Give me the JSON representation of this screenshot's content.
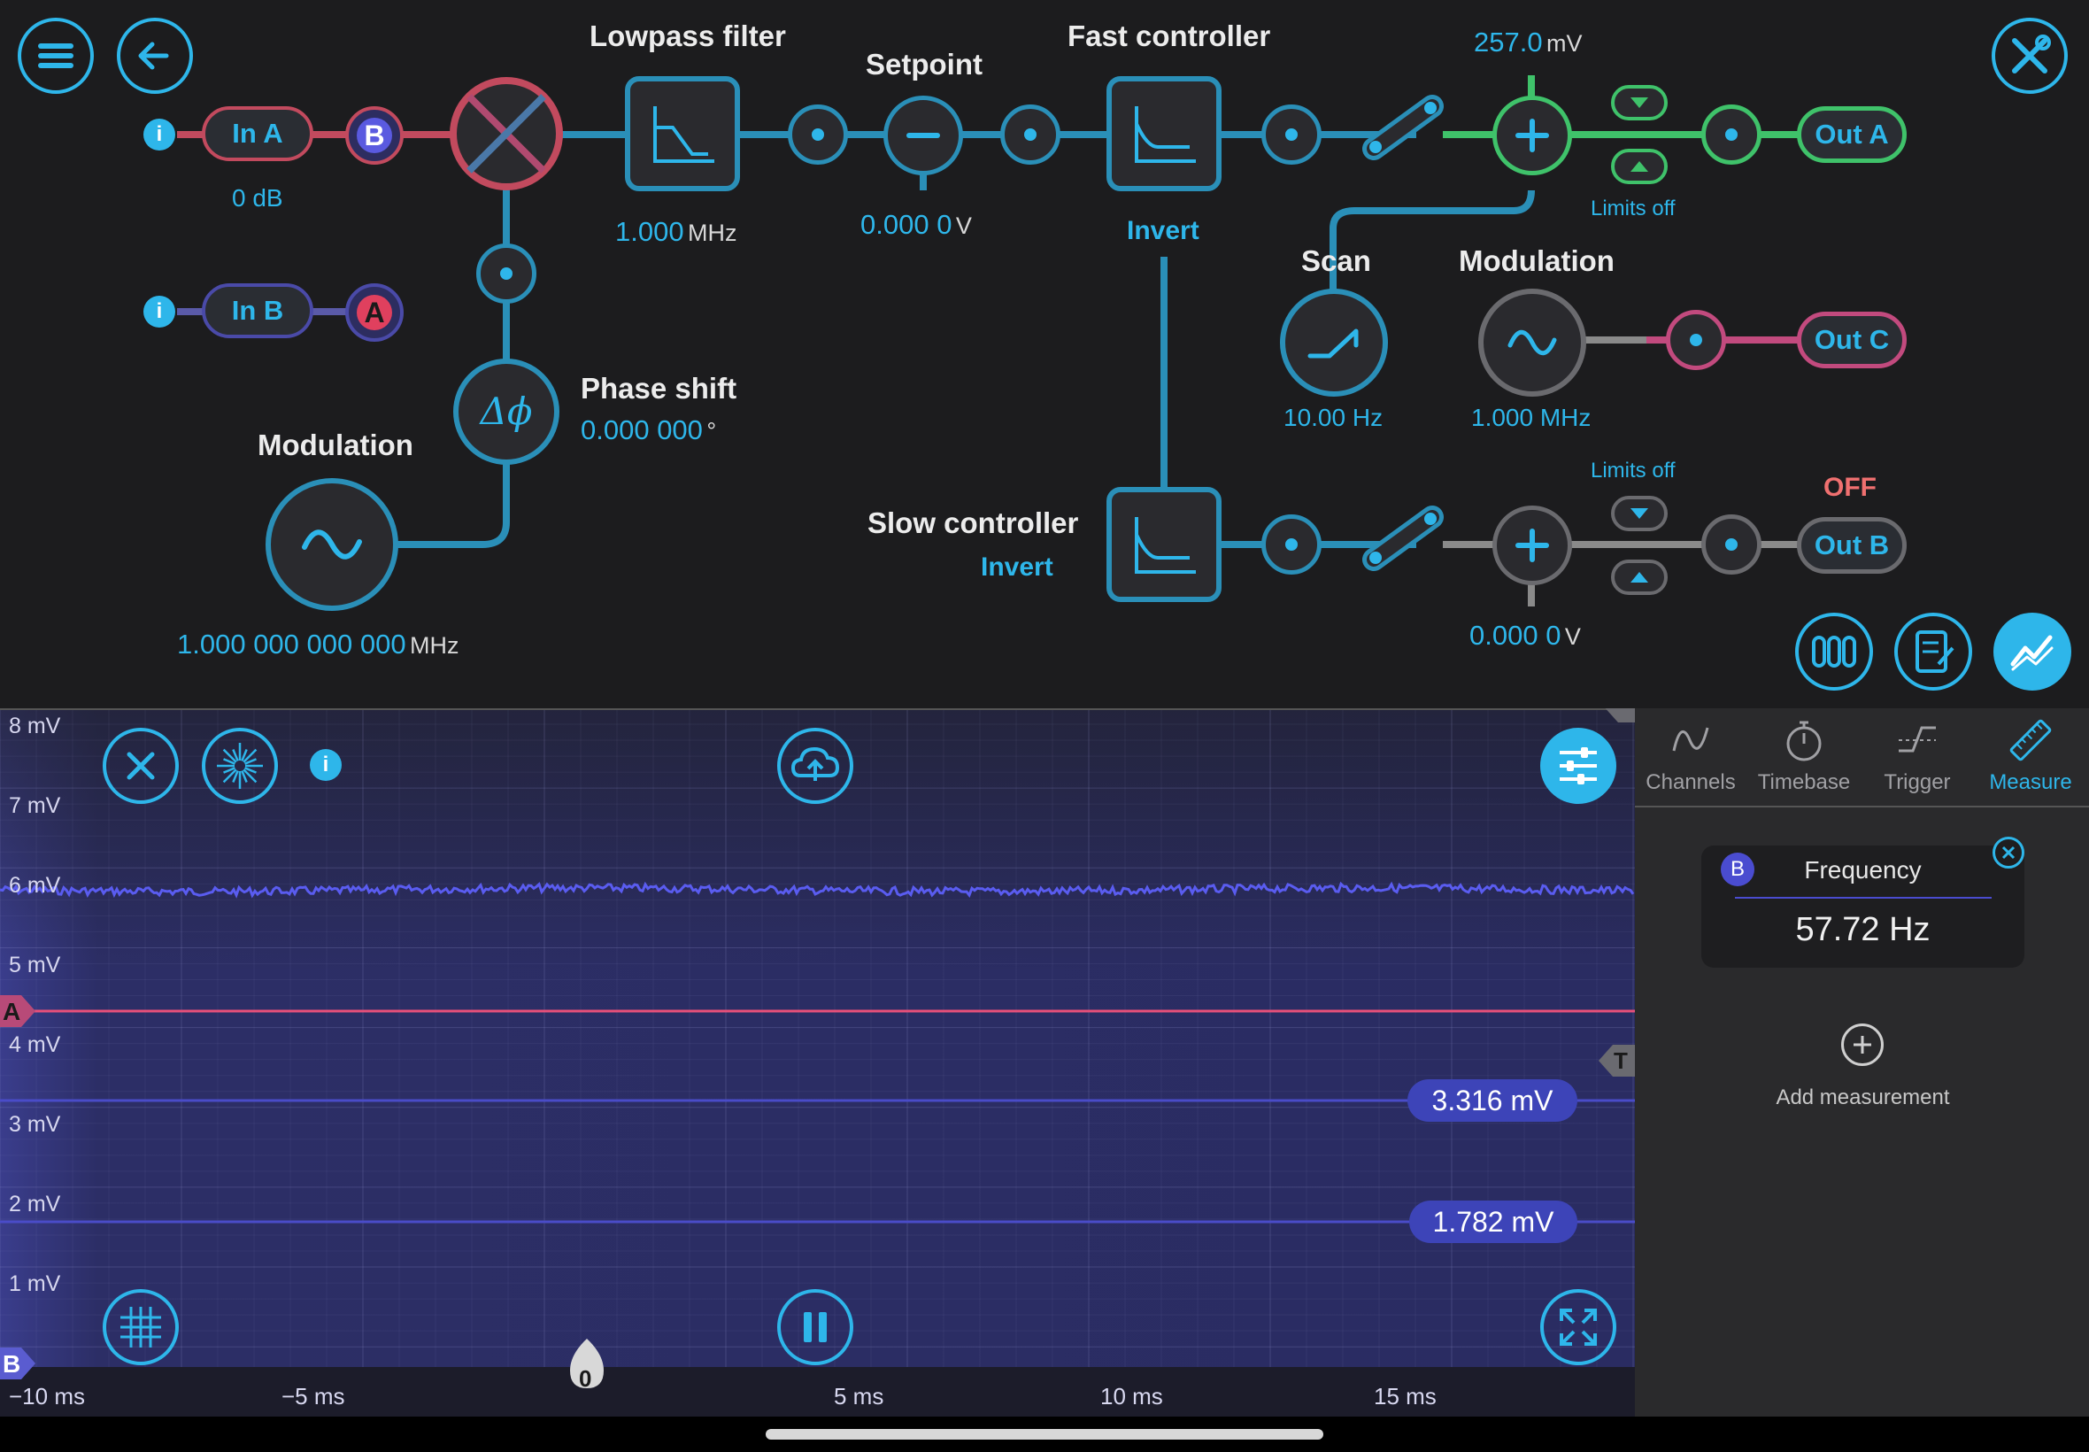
{
  "graph": {
    "in_a": {
      "label": "In A",
      "gain": "0 dB",
      "badge": "B"
    },
    "in_b": {
      "label": "In B",
      "badge": "A"
    },
    "lowpass": {
      "title": "Lowpass filter",
      "value": "1.000",
      "unit": "MHz"
    },
    "setpoint": {
      "title": "Setpoint",
      "value": "0.000 0",
      "unit": "V"
    },
    "fast_controller": {
      "title": "Fast controller",
      "invert": "Invert"
    },
    "slow_controller": {
      "title": "Slow controller",
      "invert": "Invert"
    },
    "phase_shift": {
      "title": "Phase shift",
      "value": "0.000 000",
      "unit": "°",
      "symbol": "Δϕ"
    },
    "modulation_left": {
      "title": "Modulation",
      "value": "1.000 000 000 000",
      "unit": "MHz"
    },
    "scan": {
      "title": "Scan",
      "value": "10.00 Hz"
    },
    "modulation_right": {
      "title": "Modulation",
      "value": "1.000 MHz"
    },
    "sum_a": {
      "value": "257.0",
      "unit": "mV",
      "limits": "Limits off"
    },
    "sum_b": {
      "value": "0.000 0",
      "unit": "V",
      "limits": "Limits off"
    },
    "out_a": {
      "label": "Out A"
    },
    "out_b": {
      "label": "Out B",
      "status": "OFF"
    },
    "out_c": {
      "label": "Out C"
    }
  },
  "scope": {
    "y_labels": [
      "8 mV",
      "7 mV",
      "6 mV",
      "5 mV",
      "4 mV",
      "3 mV",
      "2 mV",
      "1 mV"
    ],
    "x_labels": [
      "−10 ms",
      "−5 ms",
      "5 ms",
      "10 ms",
      "15 ms"
    ],
    "zero_marker": "0",
    "marker_a": "A",
    "marker_b": "B",
    "trigger_marker": "T",
    "cursor_1": "3.316 mV",
    "cursor_2": "1.782 mV",
    "colors": {
      "trace_b": "#5a5cf0",
      "trace_a": "#e8507a",
      "background": "#2a2c62"
    }
  },
  "panel": {
    "tabs": [
      "Channels",
      "Timebase",
      "Trigger",
      "Measure"
    ],
    "active_tab": "Measure",
    "measurement": {
      "channel": "B",
      "name": "Frequency",
      "value": "57.72 Hz"
    },
    "add_label": "Add measurement"
  },
  "icons": [
    "menu-icon",
    "back-icon",
    "settings-tools-icon",
    "info-icon",
    "close-icon",
    "laser-icon",
    "cloud-upload-icon",
    "sliders-icon",
    "grid-icon",
    "pause-icon",
    "fullscreen-icon",
    "lowpass-icon",
    "controller-icon",
    "sine-icon",
    "ramp-icon",
    "channels-icon",
    "notes-icon",
    "scope-icon"
  ]
}
